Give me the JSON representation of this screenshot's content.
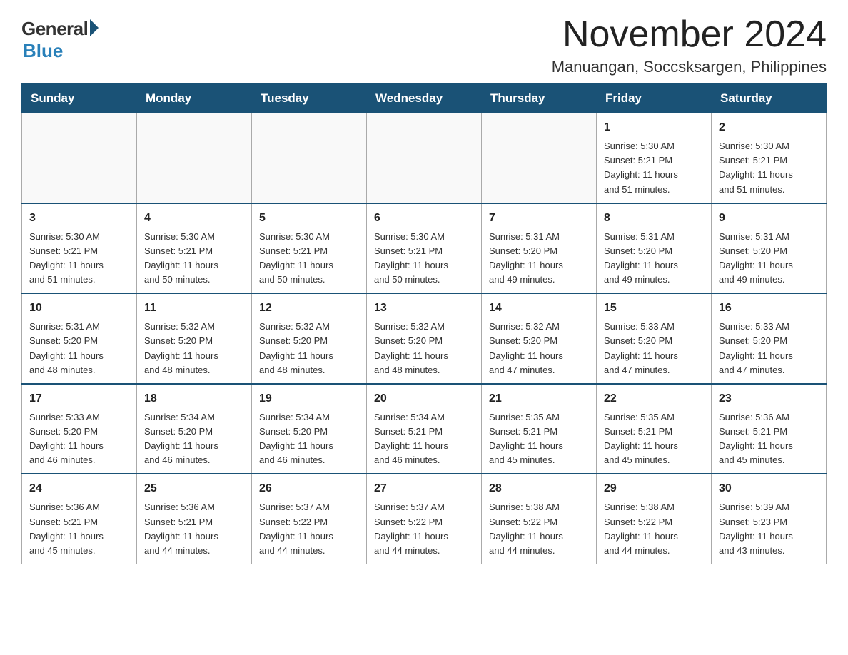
{
  "logo": {
    "general": "General",
    "blue": "Blue"
  },
  "title": "November 2024",
  "location": "Manuangan, Soccsksargen, Philippines",
  "days_of_week": [
    "Sunday",
    "Monday",
    "Tuesday",
    "Wednesday",
    "Thursday",
    "Friday",
    "Saturday"
  ],
  "weeks": [
    [
      {
        "day": "",
        "info": ""
      },
      {
        "day": "",
        "info": ""
      },
      {
        "day": "",
        "info": ""
      },
      {
        "day": "",
        "info": ""
      },
      {
        "day": "",
        "info": ""
      },
      {
        "day": "1",
        "info": "Sunrise: 5:30 AM\nSunset: 5:21 PM\nDaylight: 11 hours\nand 51 minutes."
      },
      {
        "day": "2",
        "info": "Sunrise: 5:30 AM\nSunset: 5:21 PM\nDaylight: 11 hours\nand 51 minutes."
      }
    ],
    [
      {
        "day": "3",
        "info": "Sunrise: 5:30 AM\nSunset: 5:21 PM\nDaylight: 11 hours\nand 51 minutes."
      },
      {
        "day": "4",
        "info": "Sunrise: 5:30 AM\nSunset: 5:21 PM\nDaylight: 11 hours\nand 50 minutes."
      },
      {
        "day": "5",
        "info": "Sunrise: 5:30 AM\nSunset: 5:21 PM\nDaylight: 11 hours\nand 50 minutes."
      },
      {
        "day": "6",
        "info": "Sunrise: 5:30 AM\nSunset: 5:21 PM\nDaylight: 11 hours\nand 50 minutes."
      },
      {
        "day": "7",
        "info": "Sunrise: 5:31 AM\nSunset: 5:20 PM\nDaylight: 11 hours\nand 49 minutes."
      },
      {
        "day": "8",
        "info": "Sunrise: 5:31 AM\nSunset: 5:20 PM\nDaylight: 11 hours\nand 49 minutes."
      },
      {
        "day": "9",
        "info": "Sunrise: 5:31 AM\nSunset: 5:20 PM\nDaylight: 11 hours\nand 49 minutes."
      }
    ],
    [
      {
        "day": "10",
        "info": "Sunrise: 5:31 AM\nSunset: 5:20 PM\nDaylight: 11 hours\nand 48 minutes."
      },
      {
        "day": "11",
        "info": "Sunrise: 5:32 AM\nSunset: 5:20 PM\nDaylight: 11 hours\nand 48 minutes."
      },
      {
        "day": "12",
        "info": "Sunrise: 5:32 AM\nSunset: 5:20 PM\nDaylight: 11 hours\nand 48 minutes."
      },
      {
        "day": "13",
        "info": "Sunrise: 5:32 AM\nSunset: 5:20 PM\nDaylight: 11 hours\nand 48 minutes."
      },
      {
        "day": "14",
        "info": "Sunrise: 5:32 AM\nSunset: 5:20 PM\nDaylight: 11 hours\nand 47 minutes."
      },
      {
        "day": "15",
        "info": "Sunrise: 5:33 AM\nSunset: 5:20 PM\nDaylight: 11 hours\nand 47 minutes."
      },
      {
        "day": "16",
        "info": "Sunrise: 5:33 AM\nSunset: 5:20 PM\nDaylight: 11 hours\nand 47 minutes."
      }
    ],
    [
      {
        "day": "17",
        "info": "Sunrise: 5:33 AM\nSunset: 5:20 PM\nDaylight: 11 hours\nand 46 minutes."
      },
      {
        "day": "18",
        "info": "Sunrise: 5:34 AM\nSunset: 5:20 PM\nDaylight: 11 hours\nand 46 minutes."
      },
      {
        "day": "19",
        "info": "Sunrise: 5:34 AM\nSunset: 5:20 PM\nDaylight: 11 hours\nand 46 minutes."
      },
      {
        "day": "20",
        "info": "Sunrise: 5:34 AM\nSunset: 5:21 PM\nDaylight: 11 hours\nand 46 minutes."
      },
      {
        "day": "21",
        "info": "Sunrise: 5:35 AM\nSunset: 5:21 PM\nDaylight: 11 hours\nand 45 minutes."
      },
      {
        "day": "22",
        "info": "Sunrise: 5:35 AM\nSunset: 5:21 PM\nDaylight: 11 hours\nand 45 minutes."
      },
      {
        "day": "23",
        "info": "Sunrise: 5:36 AM\nSunset: 5:21 PM\nDaylight: 11 hours\nand 45 minutes."
      }
    ],
    [
      {
        "day": "24",
        "info": "Sunrise: 5:36 AM\nSunset: 5:21 PM\nDaylight: 11 hours\nand 45 minutes."
      },
      {
        "day": "25",
        "info": "Sunrise: 5:36 AM\nSunset: 5:21 PM\nDaylight: 11 hours\nand 44 minutes."
      },
      {
        "day": "26",
        "info": "Sunrise: 5:37 AM\nSunset: 5:22 PM\nDaylight: 11 hours\nand 44 minutes."
      },
      {
        "day": "27",
        "info": "Sunrise: 5:37 AM\nSunset: 5:22 PM\nDaylight: 11 hours\nand 44 minutes."
      },
      {
        "day": "28",
        "info": "Sunrise: 5:38 AM\nSunset: 5:22 PM\nDaylight: 11 hours\nand 44 minutes."
      },
      {
        "day": "29",
        "info": "Sunrise: 5:38 AM\nSunset: 5:22 PM\nDaylight: 11 hours\nand 44 minutes."
      },
      {
        "day": "30",
        "info": "Sunrise: 5:39 AM\nSunset: 5:23 PM\nDaylight: 11 hours\nand 43 minutes."
      }
    ]
  ]
}
